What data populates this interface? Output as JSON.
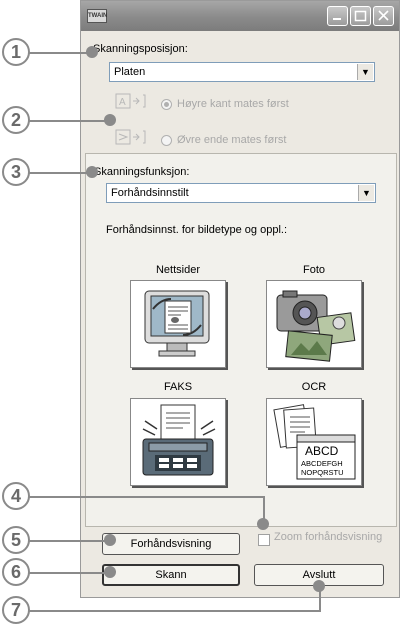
{
  "titlebar": {
    "app_icon_text": "TWAIN"
  },
  "scan_position": {
    "label": "Skanningsposisjon:",
    "value": "Platen"
  },
  "feed_options": {
    "right_edge": "Høyre kant mates først",
    "top_edge": "Øvre ende mates først"
  },
  "scan_function": {
    "label": "Skanningsfunksjon:",
    "value": "Forhåndsinnstilt",
    "preset_caption": "Forhåndsinnst. for bildetype og oppl.:"
  },
  "presets": [
    {
      "label": "Nettsider",
      "icon": "web-page-icon"
    },
    {
      "label": "Foto",
      "icon": "camera-photo-icon"
    },
    {
      "label": "FAKS",
      "icon": "fax-icon"
    },
    {
      "label": "OCR",
      "icon": "ocr-document-icon"
    }
  ],
  "ocr_sample": {
    "line1": "ABCD",
    "line2": "ABCDEFGH",
    "line3": "NOPQRSTU"
  },
  "preview_button": "Forhåndsvisning",
  "zoom_preview": "Zoom forhåndsvisning",
  "scan_button": "Skann",
  "exit_button": "Avslutt",
  "callouts": [
    "1",
    "2",
    "3",
    "4",
    "5",
    "6",
    "7"
  ],
  "colors": {
    "window_bg": "#ece9e2",
    "callout_gray": "#8a8a8a",
    "titlebar": "#8a8a8a"
  }
}
